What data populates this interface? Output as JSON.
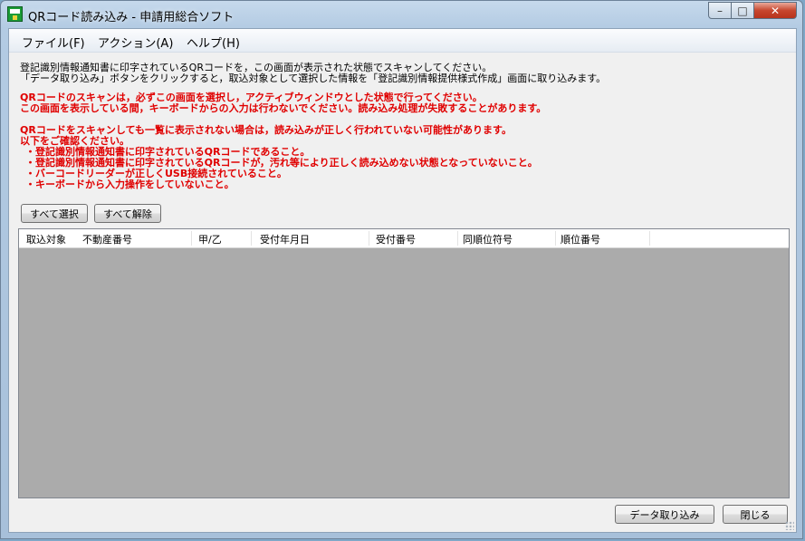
{
  "window": {
    "title": "QRコード読み込み - 申請用総合ソフト",
    "controls": {
      "minimize": "–",
      "maximize": "□",
      "close": "✕"
    }
  },
  "menu": [
    {
      "label": "ファイル(F)"
    },
    {
      "label": "アクション(A)"
    },
    {
      "label": "ヘルプ(H)"
    }
  ],
  "instructions": {
    "line1": "登記識別情報通知書に印字されているQRコードを，この画面が表示された状態でスキャンしてください。",
    "line2": "「データ取り込み」ボタンをクリックすると，取込対象として選択した情報を「登記識別情報提供様式作成」画面に取り込みます。"
  },
  "warnings": {
    "w1": "QRコードのスキャンは，必ずこの画面を選択し，アクティブウィンドウとした状態で行ってください。",
    "w2": "この画面を表示している間，キーボードからの入力は行わないでください。読み込み処理が失敗することがあります。",
    "w3": "QRコードをスキャンしても一覧に表示されない場合は，読み込みが正しく行われていない可能性があります。",
    "w4": "以下をご確認ください。",
    "checks": [
      "・登記識別情報通知書に印字されているQRコードであること。",
      "・登記識別情報通知書に印字されているQRコードが，汚れ等により正しく読み込めない状態となっていないこと。",
      "・バーコードリーダーが正しくUSB接続されていること。",
      "・キーボードから入力操作をしていないこと。"
    ]
  },
  "buttons": {
    "select_all": "すべて選択",
    "deselect_all": "すべて解除",
    "import": "データ取り込み",
    "close": "閉じる"
  },
  "table": {
    "columns": [
      "取込対象",
      "不動産番号",
      "甲/乙",
      "受付年月日",
      "受付番号",
      "同順位符号",
      "順位番号"
    ],
    "rows": []
  }
}
